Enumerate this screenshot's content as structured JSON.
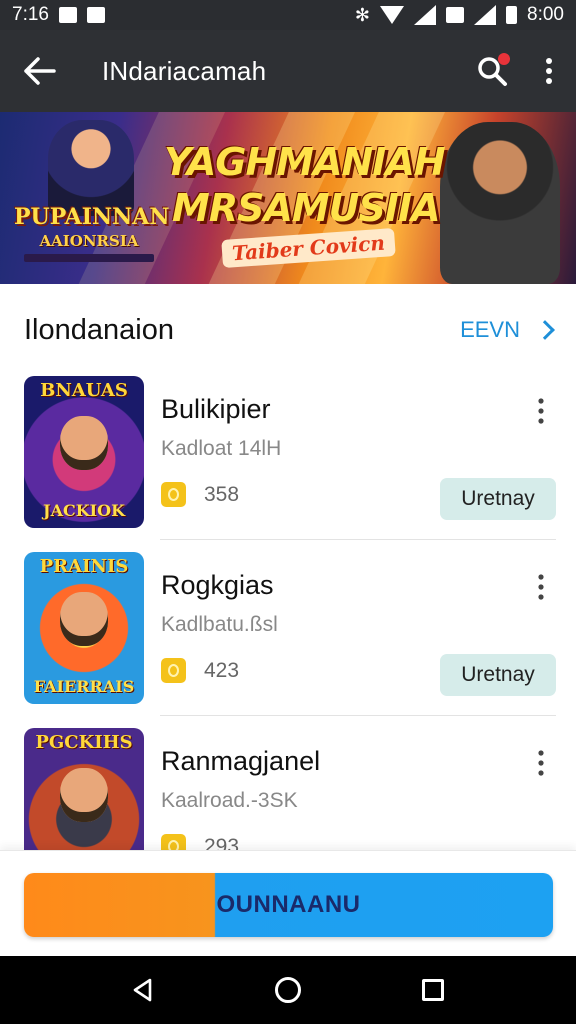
{
  "status_bar": {
    "time": "7:16",
    "clock_right": "8:00"
  },
  "app_bar": {
    "title": "INdariacamah"
  },
  "banner": {
    "left_title": "PUPAINNAN",
    "left_subtitle": "AAIONRSIA",
    "headline_line1": "YAGHMANIAH",
    "headline_line2": "MRSAMUSIIA",
    "tagline": "Taiber Covicn"
  },
  "section": {
    "title": "Ilondanaion",
    "link_label": "EEVN"
  },
  "apps": [
    {
      "name": "Bulikipier",
      "subtitle": "Kadloat 14lH",
      "rating": "358",
      "action": "Uretnay",
      "thumb_top": "BNAUAS",
      "thumb_bottom": "JACKIOK"
    },
    {
      "name": "Rogkgias",
      "subtitle": "Kadlbatu.ßsl",
      "rating": "423",
      "action": "Uretnay",
      "thumb_top": "PRAINIS",
      "thumb_bottom": "FAIERRAIS"
    },
    {
      "name": "Ranmagjanel",
      "subtitle": "Kaalroad.-3SK",
      "rating": "293",
      "thumb_top": "PGCKIHS",
      "thumb_bottom": ""
    }
  ],
  "cta": {
    "label": "OUNNAANU"
  },
  "colors": {
    "accent_blue": "#1da1f2",
    "accent_orange": "#f7941d",
    "action_bg": "#d6ecea",
    "appbar": "#2e3034"
  }
}
